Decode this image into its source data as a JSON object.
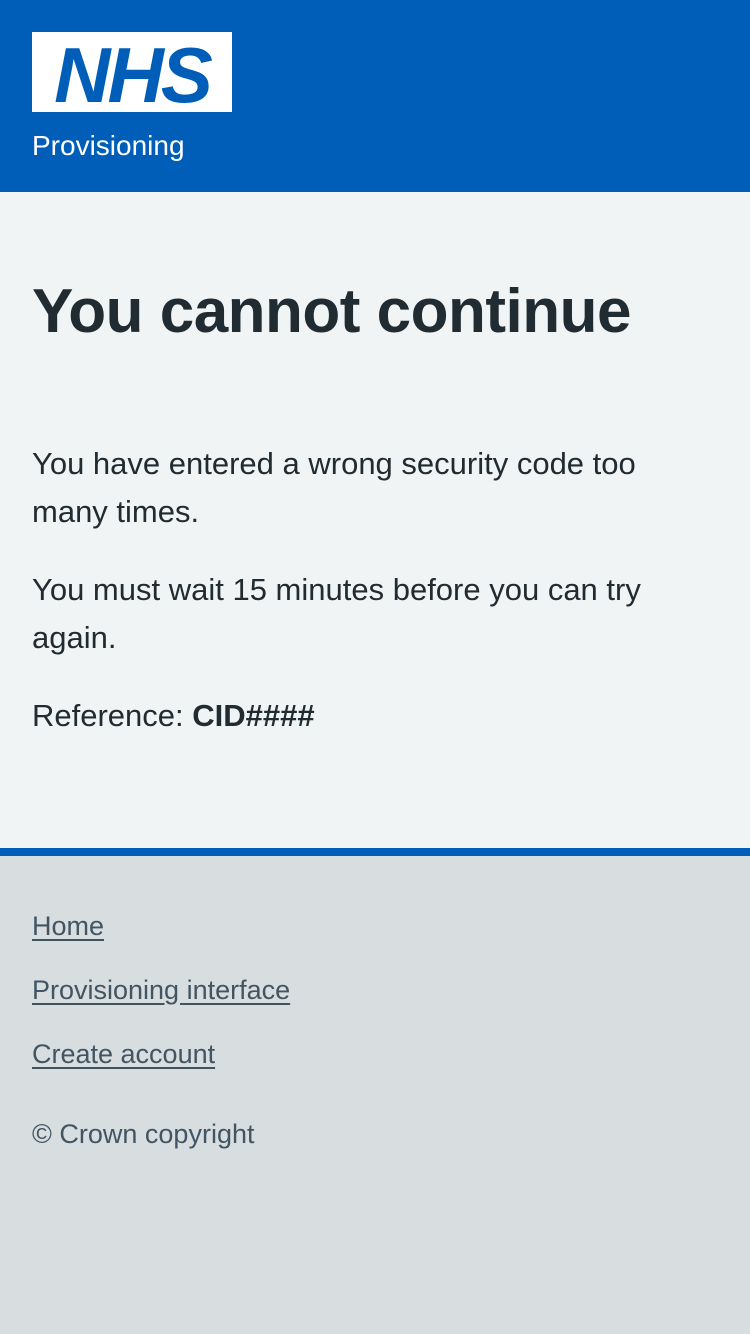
{
  "header": {
    "logo_text": "NHS",
    "service_name": "Provisioning",
    "brand_color": "#005eb8"
  },
  "main": {
    "title": "You cannot continue",
    "paragraph1": "You have entered a wrong security code too many times.",
    "paragraph2": "You must wait 15 minutes before you can try again.",
    "reference_label": "Reference: ",
    "reference_value": "CID####"
  },
  "footer": {
    "links": [
      {
        "label": "Home"
      },
      {
        "label": "Provisioning interface"
      },
      {
        "label": "Create account"
      }
    ],
    "copyright": "© Crown copyright"
  }
}
